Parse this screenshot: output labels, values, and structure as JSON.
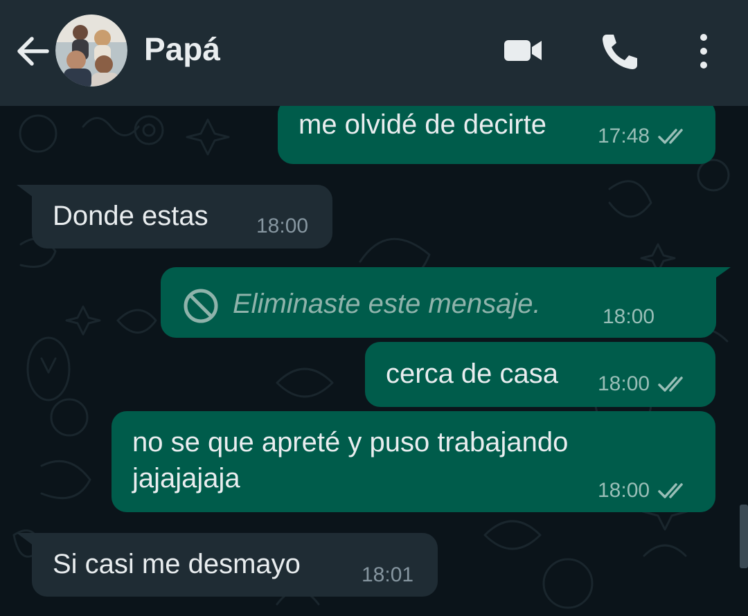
{
  "header": {
    "contact_name": "Papá",
    "icons": {
      "back": "arrow-left-icon",
      "avatar": "contact-avatar",
      "video": "video-camera-icon",
      "call": "phone-icon",
      "menu": "more-vertical-icon"
    }
  },
  "colors": {
    "header_bg": "#1f2c34",
    "chat_bg": "#0b141a",
    "outgoing_bubble": "#005c4b",
    "incoming_bubble": "#1f2c34",
    "text": "#e9edef",
    "meta_outgoing": "#99beb7",
    "meta_incoming": "#8696a0"
  },
  "messages": [
    {
      "direction": "outgoing",
      "text": "me olvidé de decirte",
      "time": "17:48",
      "status": "read-double-check"
    },
    {
      "direction": "incoming",
      "text": "Donde estas",
      "time": "18:00"
    },
    {
      "direction": "outgoing",
      "text": "Eliminaste este mensaje.",
      "time": "18:00",
      "deleted": true,
      "icon": "blocked-icon"
    },
    {
      "direction": "outgoing",
      "text": "cerca de casa",
      "time": "18:00",
      "status": "read-double-check"
    },
    {
      "direction": "outgoing",
      "lines": [
        "no se que apreté y puso trabajando",
        "jajajajaja"
      ],
      "time": "18:00",
      "status": "read-double-check"
    },
    {
      "direction": "incoming",
      "text": "Si casi me desmayo",
      "time": "18:01"
    }
  ]
}
